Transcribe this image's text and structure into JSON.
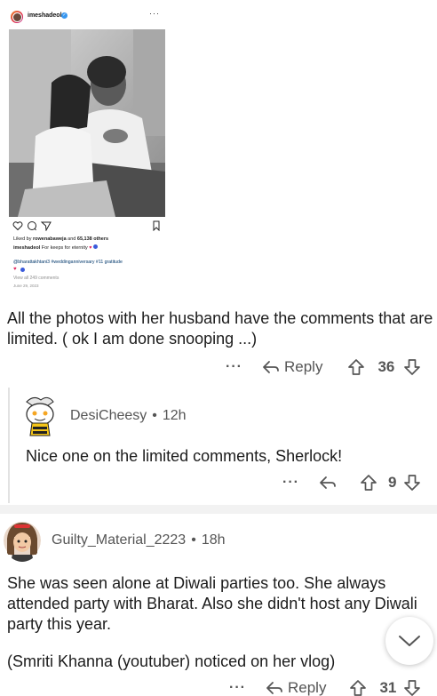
{
  "instagram_post": {
    "username": "imeshadeol",
    "more": "···",
    "likes": {
      "prefix": "Liked by",
      "user": "rowenabaweja",
      "middle": "and",
      "count": "65,138 others"
    },
    "caption": {
      "user": "imeshadeol",
      "text": "For keeps for eternity"
    },
    "tags": "@bharattakhtani3 #weddinganniversary #11 gratitude",
    "view_comments": "View all 249 comments",
    "date": "June 29, 2023"
  },
  "comments": [
    {
      "text": "All the photos with her husband have the comments that are limited. ( ok I am done snooping ...)",
      "reply_label": "Reply",
      "score": "36"
    },
    {
      "author": "DesiCheesy",
      "age": "12h",
      "text": "Nice one on the limited comments, Sherlock!",
      "score": "9"
    },
    {
      "author": "Guilty_Material_2223",
      "age": "18h",
      "text": "She was seen alone at Diwali parties too. She always attended party with Bharat. Also she didn't host any Diwali party this year.",
      "text2": "(Smriti Khanna (youtuber) noticed on her vlog)",
      "reply_label": "Reply",
      "score": "31"
    }
  ],
  "ui": {
    "more_dots": "···",
    "separator": "•"
  },
  "colors": {
    "text": "#1c1c1c",
    "meta": "#555555",
    "thread_line": "#e2e2e2",
    "verified": "#3897f0"
  }
}
